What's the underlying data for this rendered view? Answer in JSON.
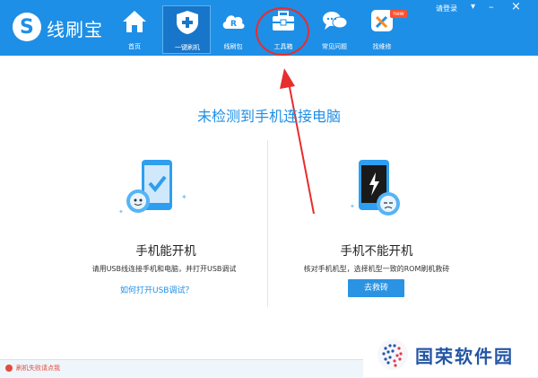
{
  "app": {
    "name": "线刷宝"
  },
  "nav": [
    {
      "label": "首页"
    },
    {
      "label": "一键刷机"
    },
    {
      "label": "线刷包"
    },
    {
      "label": "工具箱"
    },
    {
      "label": "常见问题"
    },
    {
      "label": "找维修",
      "badge": "new"
    }
  ],
  "window": {
    "login": "请登录",
    "minimize": "–",
    "close": "×"
  },
  "main": {
    "headline": "未检测到手机连接电脑",
    "left": {
      "title": "手机能开机",
      "desc": "请用USB线连接手机和电脑，并打开USB调试",
      "link": "如何打开USB调试？"
    },
    "right": {
      "title": "手机不能开机",
      "desc": "核对手机机型，选择机型一致的ROM刷机救砖",
      "button": "去救砖"
    }
  },
  "status": {
    "text": "刷机失败请点我"
  },
  "watermark": {
    "text": "国荣软件园"
  },
  "colors": {
    "primary": "#1e8fe6",
    "annotation": "#e82d2d"
  }
}
